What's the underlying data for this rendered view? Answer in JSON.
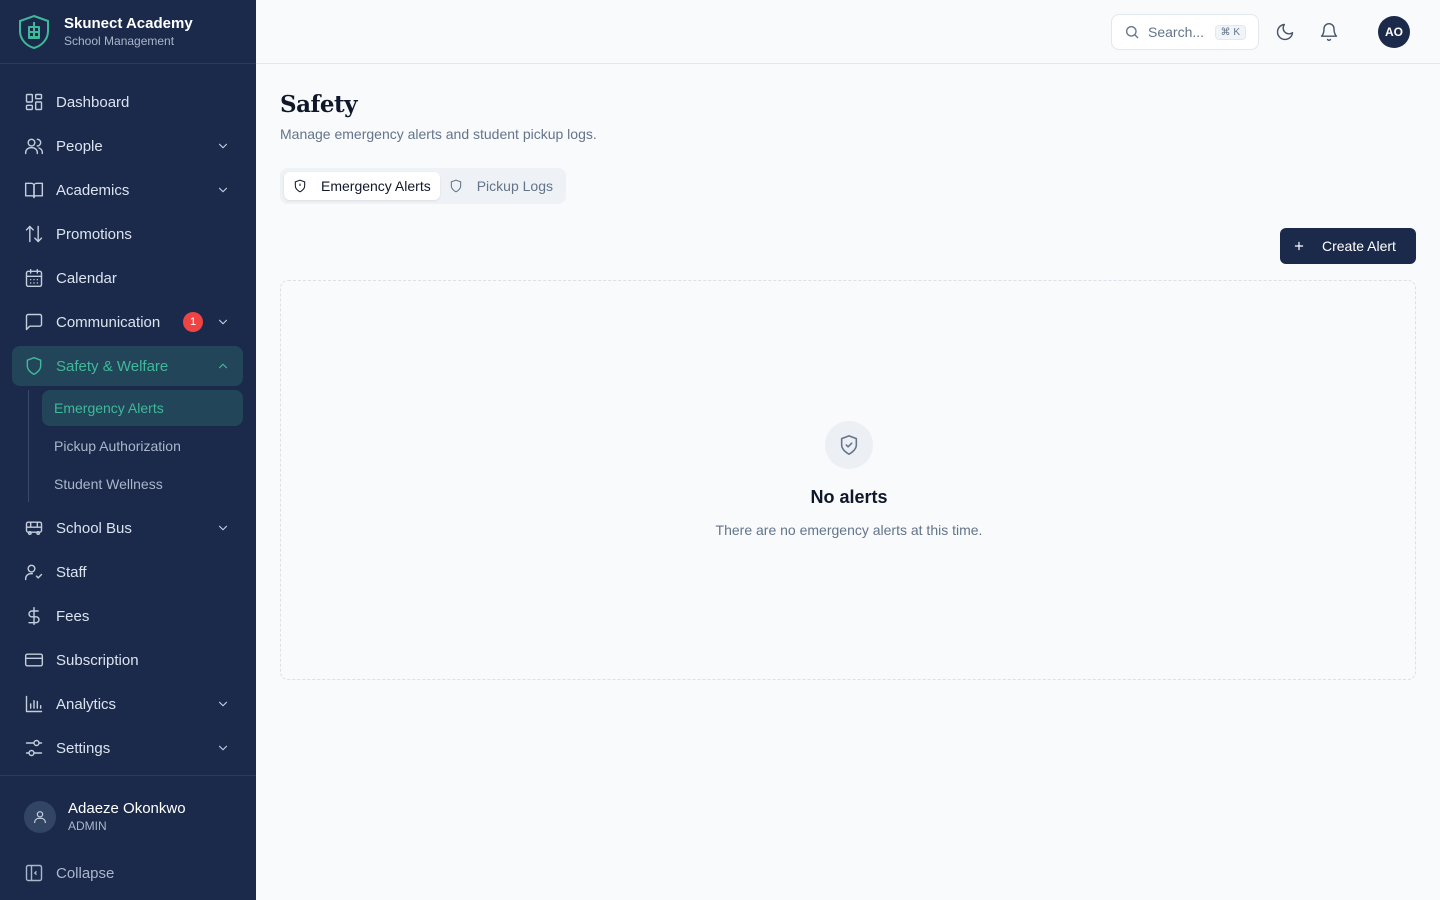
{
  "brand": {
    "name": "Skunect Academy",
    "subtitle": "School Management"
  },
  "sidebar": {
    "items": [
      {
        "label": "Dashboard"
      },
      {
        "label": "People"
      },
      {
        "label": "Academics"
      },
      {
        "label": "Promotions"
      },
      {
        "label": "Calendar"
      },
      {
        "label": "Communication",
        "badge": "1"
      },
      {
        "label": "Safety & Welfare",
        "sub": [
          {
            "label": "Emergency Alerts"
          },
          {
            "label": "Pickup Authorization"
          },
          {
            "label": "Student Wellness"
          }
        ]
      },
      {
        "label": "School Bus"
      },
      {
        "label": "Staff"
      },
      {
        "label": "Fees"
      },
      {
        "label": "Subscription"
      },
      {
        "label": "Analytics"
      },
      {
        "label": "Settings"
      }
    ],
    "user": {
      "name": "Adaeze Okonkwo",
      "role": "ADMIN"
    },
    "collapse_label": "Collapse"
  },
  "topbar": {
    "search_placeholder": "Search...",
    "search_shortcut": "⌘ K",
    "avatar_initials": "AO"
  },
  "page": {
    "title": "Safety",
    "description": "Manage emergency alerts and student pickup logs.",
    "tabs": [
      {
        "label": "Emergency Alerts"
      },
      {
        "label": "Pickup Logs"
      }
    ],
    "create_button": "Create Alert",
    "empty": {
      "title": "No alerts",
      "description": "There are no emergency alerts at this time."
    }
  },
  "colors": {
    "sidebar_bg": "#1b2a4a",
    "accent": "#3fb99a",
    "badge": "#ef4444",
    "primary_button": "#1b2a4a"
  }
}
